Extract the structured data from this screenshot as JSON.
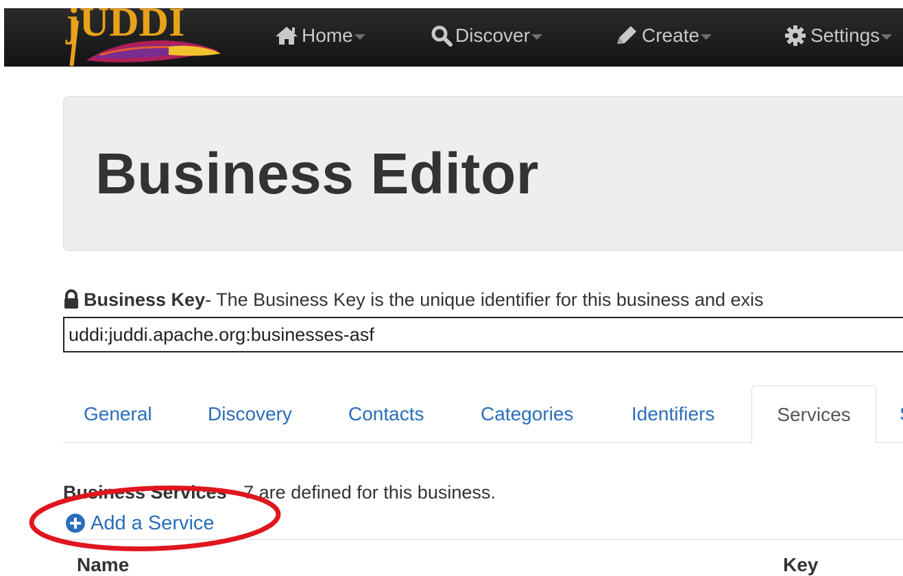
{
  "nav": {
    "logo_text": "jUDDI",
    "items": [
      {
        "label": "Home",
        "icon": "home-icon"
      },
      {
        "label": "Discover",
        "icon": "search-icon"
      },
      {
        "label": "Create",
        "icon": "pencil-icon"
      },
      {
        "label": "Settings",
        "icon": "gear-icon"
      }
    ]
  },
  "page": {
    "title": "Business Editor"
  },
  "business_key": {
    "label": "Business Key",
    "description": "- The Business Key is the unique identifier for this business and exis",
    "value": "uddi:juddi.apache.org:businesses-asf"
  },
  "tabs": [
    {
      "label": "General"
    },
    {
      "label": "Discovery"
    },
    {
      "label": "Contacts"
    },
    {
      "label": "Categories"
    },
    {
      "label": "Identifiers"
    },
    {
      "label": "Services"
    },
    {
      "label": "S"
    }
  ],
  "services": {
    "heading": "Business Services",
    "summary": "- 7 are defined for this business.",
    "add_label": "Add a Service",
    "columns": [
      "Name",
      "Key"
    ]
  },
  "colors": {
    "navbar": "#1b1b1b",
    "link": "#2a6ebb",
    "annotation": "#e0161f"
  }
}
